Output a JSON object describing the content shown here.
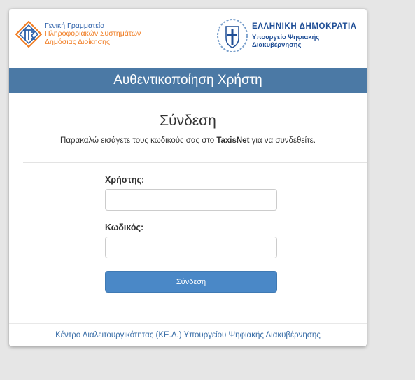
{
  "header": {
    "gsis_lines": [
      "Γενική Γραμματεία",
      "Πληροφοριακών Συστημάτων",
      "Δημόσιας Διοίκησης"
    ],
    "republic_title": "ΕΛΛΗΝΙΚΗ ΔΗΜΟΚΡΑΤΙΑ",
    "ministry_lines": [
      "Υπουργείο Ψηφιακής",
      "Διακυβέρνησης"
    ]
  },
  "banner": {
    "title": "Αυθεντικοποίηση Χρήστη"
  },
  "login": {
    "title": "Σύνδεση",
    "intro_before": "Παρακαλώ εισάγετε τους κωδικούς σας στο ",
    "intro_bold": "TaxisNet",
    "intro_after": " για να συνδεθείτε."
  },
  "form": {
    "username_label": "Χρήστης:",
    "username_value": "",
    "password_label": "Κωδικός:",
    "password_value": "",
    "submit_label": "Σύνδεση"
  },
  "footer": {
    "text": "Κέντρο Διαλειτουργικότητας (ΚΕ.Δ.) Υπουργείου Ψηφιακής Διακυβέρνησης"
  },
  "colors": {
    "banner": "#4b79a5",
    "button": "#4a88c7",
    "footer_link": "#3b6fa8",
    "gsis_orange": "#f07c22",
    "gsis_blue": "#2a5ea8"
  },
  "icons": {
    "gsis_logo": "gsis-logo-icon",
    "republic_emblem": "greek-emblem-icon"
  }
}
